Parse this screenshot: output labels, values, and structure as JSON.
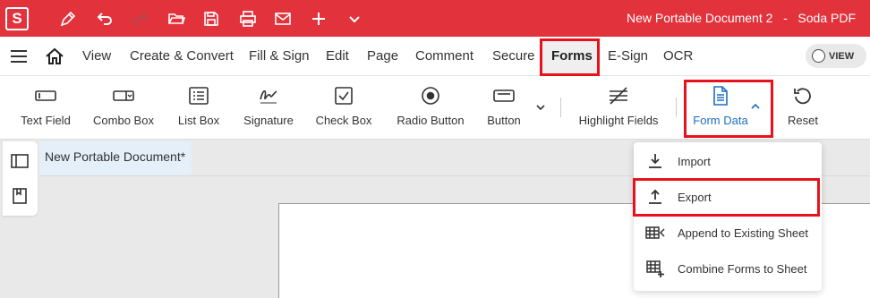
{
  "app": {
    "logo_letter": "S",
    "document_title": "New Portable Document 2   -   Soda PDF",
    "brand_color": "#e2323c"
  },
  "quick_access": [
    {
      "name": "edit-pen-icon"
    },
    {
      "name": "undo-icon"
    },
    {
      "name": "redo-icon"
    },
    {
      "name": "open-folder-icon"
    },
    {
      "name": "save-icon"
    },
    {
      "name": "print-icon"
    },
    {
      "name": "mail-icon"
    },
    {
      "name": "plus-icon"
    },
    {
      "name": "chevron-down-icon"
    }
  ],
  "menu": {
    "items": [
      "View",
      "Create & Convert",
      "Fill & Sign",
      "Edit",
      "Page",
      "Comment",
      "Secure",
      "Forms",
      "E-Sign",
      "OCR"
    ],
    "active": "Forms",
    "view_toggle_label": "VIEW"
  },
  "ribbon": {
    "tools": [
      {
        "label": "Text Field",
        "icon": "text-field-icon"
      },
      {
        "label": "Combo Box",
        "icon": "combo-box-icon"
      },
      {
        "label": "List Box",
        "icon": "list-box-icon"
      },
      {
        "label": "Signature",
        "icon": "signature-icon"
      },
      {
        "label": "Check Box",
        "icon": "check-box-icon"
      },
      {
        "label": "Radio Button",
        "icon": "radio-button-icon"
      },
      {
        "label": "Button",
        "icon": "button-icon"
      },
      {
        "label": "Highlight Fields",
        "icon": "highlight-fields-icon"
      },
      {
        "label": "Form Data",
        "icon": "form-data-icon"
      },
      {
        "label": "Reset",
        "icon": "reset-icon"
      }
    ],
    "accent_color": "#1a6fc4"
  },
  "document_tab": {
    "label": "New Portable Document*"
  },
  "form_data_menu": {
    "items": [
      {
        "label": "Import",
        "icon": "import-icon"
      },
      {
        "label": "Export",
        "icon": "export-icon"
      },
      {
        "label": "Append to Existing Sheet",
        "icon": "append-sheet-icon"
      },
      {
        "label": "Combine Forms to Sheet",
        "icon": "combine-sheet-icon"
      }
    ]
  },
  "highlight_color": "#e8121c"
}
